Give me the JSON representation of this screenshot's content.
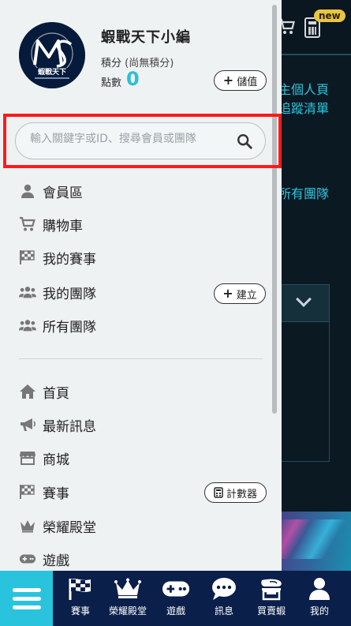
{
  "background": {
    "new_badge": "new",
    "text1": "主個人頁",
    "text2": "追蹤清單",
    "text3": "所有團隊"
  },
  "drawer": {
    "username": "蝦戰天下小編",
    "points_label": "積分",
    "points_value": "(尚無積分)",
    "coins_label": "點數",
    "coins_value": "0",
    "topup_button": "儲值",
    "search": {
      "placeholder": "輸入關鍵字或ID、搜尋會員或團隊"
    },
    "menu_top": [
      {
        "label": "會員區",
        "icon": "user-icon"
      },
      {
        "label": "購物車",
        "icon": "cart-icon"
      },
      {
        "label": "我的賽事",
        "icon": "checkered-flag-icon"
      },
      {
        "label": "我的團隊",
        "icon": "team-icon"
      },
      {
        "label": "所有團隊",
        "icon": "team-icon"
      }
    ],
    "create_button": "建立",
    "menu_bottom": [
      {
        "label": "首頁",
        "icon": "home-icon"
      },
      {
        "label": "最新訊息",
        "icon": "megaphone-icon"
      },
      {
        "label": "商城",
        "icon": "store-icon"
      },
      {
        "label": "賽事",
        "icon": "checkered-flag-icon"
      },
      {
        "label": "榮耀殿堂",
        "icon": "crown-icon"
      },
      {
        "label": "遊戲",
        "icon": "gamepad-icon"
      }
    ],
    "counter_button": "計數器"
  },
  "bottom_nav": {
    "items": [
      {
        "label": "賽事",
        "icon": "checkered-flag-icon"
      },
      {
        "label": "榮耀殿堂",
        "icon": "crown-icon"
      },
      {
        "label": "遊戲",
        "icon": "gamepad-icon"
      },
      {
        "label": "訊息",
        "icon": "chat-icon"
      },
      {
        "label": "買賣蝦",
        "icon": "shrimp-trade-icon"
      },
      {
        "label": "我的",
        "icon": "user-icon"
      }
    ]
  },
  "colors": {
    "accent": "#2bbfd6",
    "highlight": "#ff1a1a",
    "nav_bg": "#0a1f4a",
    "drawer_bg": "#eef2f3"
  }
}
